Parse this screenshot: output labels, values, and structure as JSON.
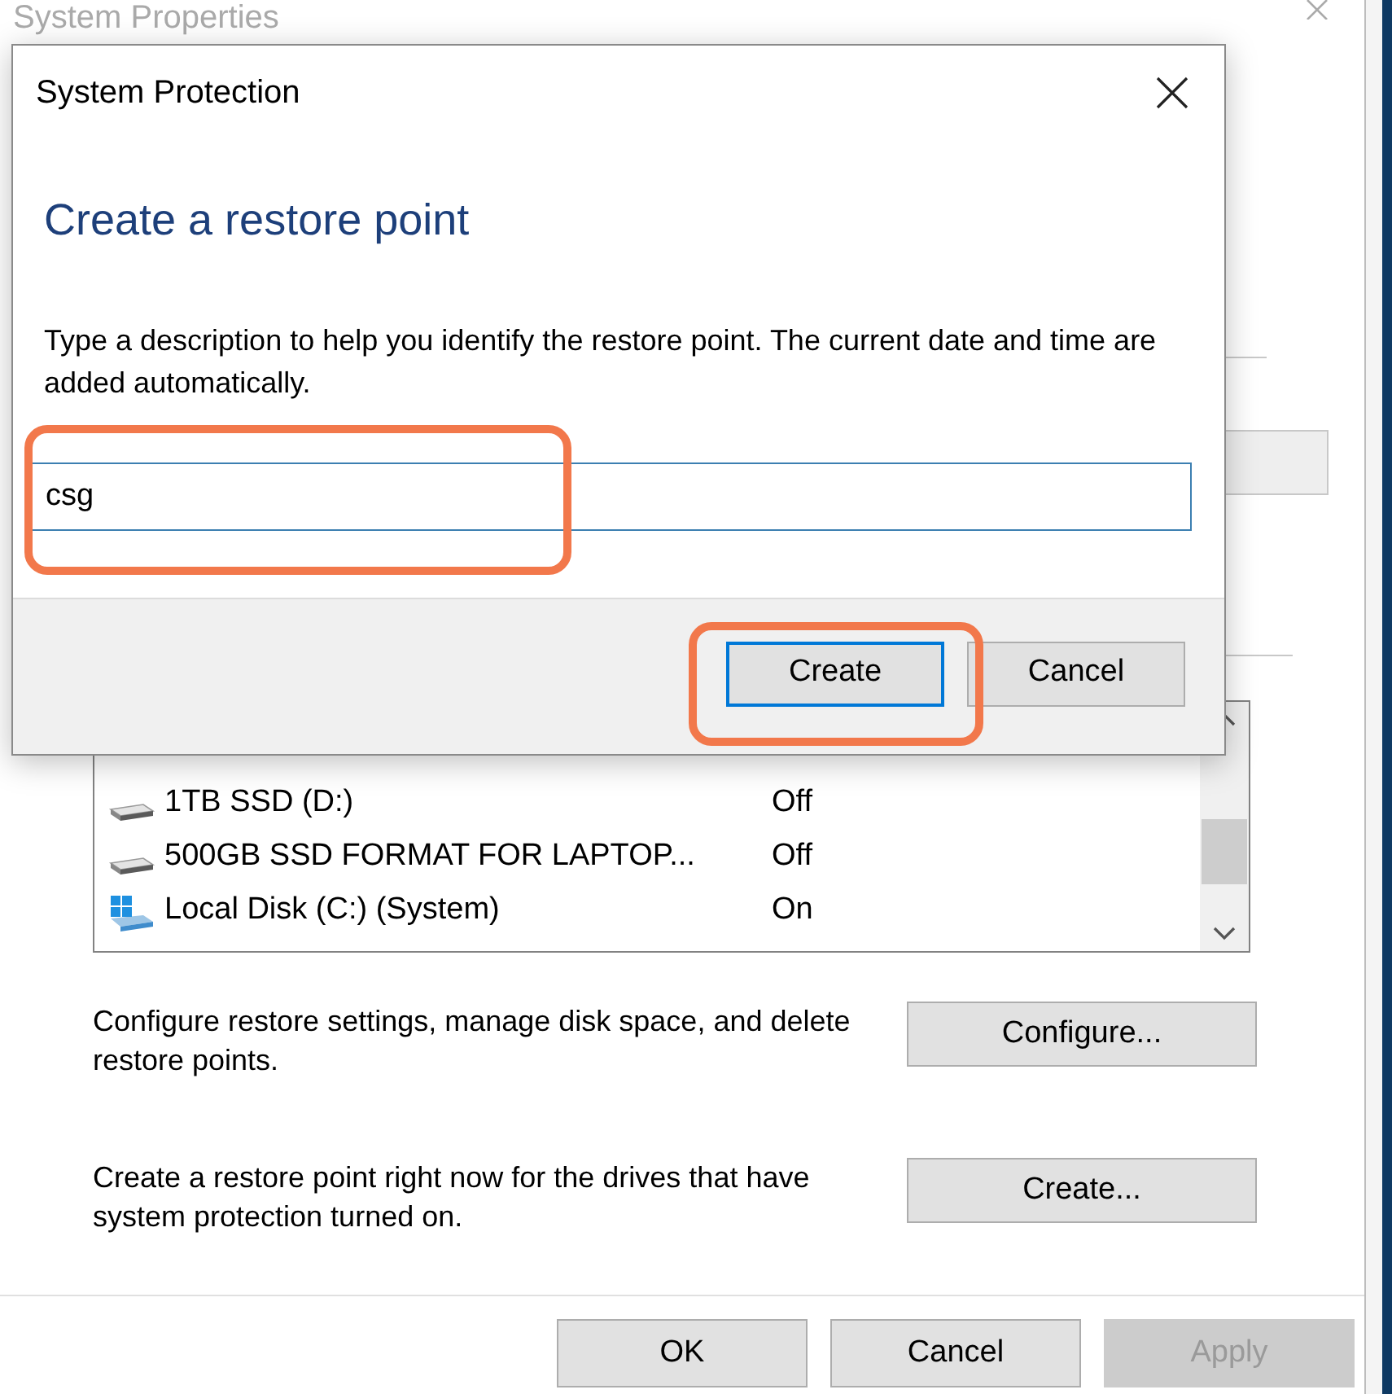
{
  "background_window": {
    "title": "System Properties",
    "drives": [
      {
        "name": "1TB SSD (D:)",
        "status": "Off",
        "kind": "drive"
      },
      {
        "name": "500GB SSD FORMAT FOR LAPTOP...",
        "status": "Off",
        "kind": "drive"
      },
      {
        "name": "Local Disk (C:) (System)",
        "status": "On",
        "kind": "system"
      }
    ],
    "actions": [
      {
        "description": "Configure restore settings, manage disk space, and delete restore points.",
        "button": "Configure..."
      },
      {
        "description": "Create a restore point right now for the drives that have system protection turned on.",
        "button": "Create..."
      }
    ],
    "buttons": [
      {
        "label": "OK",
        "disabled": false
      },
      {
        "label": "Cancel",
        "disabled": false
      },
      {
        "label": "Apply",
        "disabled": true
      }
    ]
  },
  "dialog": {
    "title": "System Protection",
    "heading": "Create a restore point",
    "description": "Type a description to help you identify the restore point. The current date and time are added automatically.",
    "input": {
      "value": "csg"
    },
    "buttons": [
      {
        "label": "Create",
        "focused": true
      },
      {
        "label": "Cancel",
        "focused": false
      }
    ]
  }
}
